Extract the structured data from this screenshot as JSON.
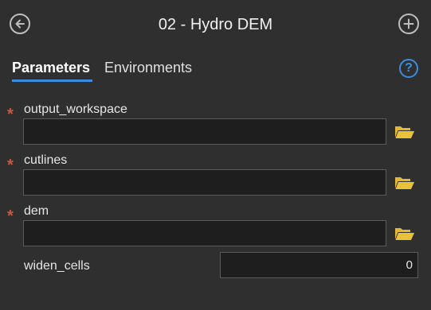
{
  "header": {
    "title": "02 - Hydro DEM"
  },
  "tabs": [
    {
      "label": "Parameters"
    },
    {
      "label": "Environments"
    }
  ],
  "help": {
    "glyph": "?"
  },
  "required_marker": "*",
  "params": [
    {
      "label": "output_workspace",
      "value": "",
      "required": true
    },
    {
      "label": "cutlines",
      "value": "",
      "required": true
    },
    {
      "label": "dem",
      "value": "",
      "required": true
    },
    {
      "label": "widen_cells",
      "value": "0",
      "required": false
    }
  ],
  "colors": {
    "background": "#2f2f2f",
    "input_bg": "#1e1e1e",
    "accent": "#3a8de0",
    "required": "#d0573f",
    "folder": "#e0b836"
  },
  "icons": {
    "back": "back-circle-arrow-icon",
    "add": "add-circle-plus-icon",
    "help": "help-question-icon",
    "folder": "open-folder-icon"
  }
}
